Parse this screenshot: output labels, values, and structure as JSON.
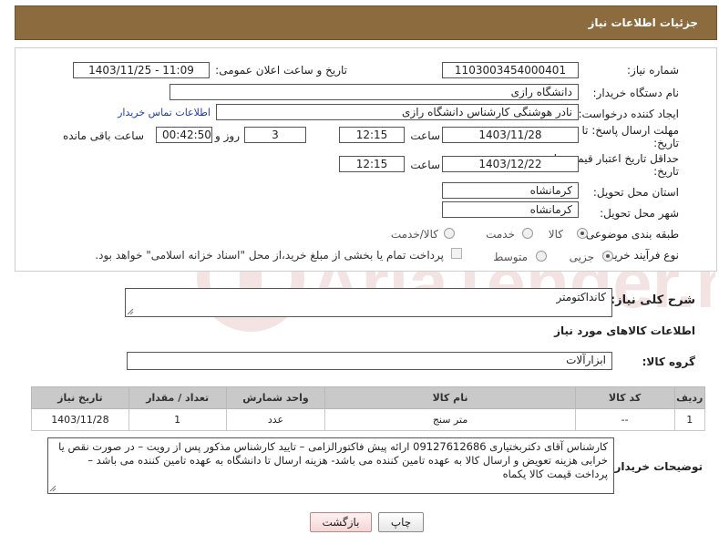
{
  "header": {
    "title": "جزئیات اطلاعات نیاز"
  },
  "form": {
    "need_number_label": "شماره نیاز:",
    "need_number": "1103003454000401",
    "announce_label": "تاریخ و ساعت اعلان عمومی:",
    "announce_value": "1403/11/25 - 11:09",
    "buyer_org_label": "نام دستگاه خریدار:",
    "buyer_org": "دانشگاه رازی",
    "requester_label": "ایجاد کننده درخواست:",
    "requester": "نادر هوشنگی کارشناس دانشگاه رازی",
    "contact_link": "اطلاعات تماس خریدار",
    "deadline_label_1": "مهلت ارسال پاسخ: تا",
    "deadline_label_2": "تاریخ:",
    "deadline_date": "1403/11/28",
    "time_label": "ساعت",
    "deadline_time": "12:15",
    "days_value": "3",
    "days_label": "روز و",
    "remaining_time": "00:42:50",
    "remaining_label": "ساعت باقی مانده",
    "validity_label_1": "حداقل تاریخ اعتبار قیمت: تا",
    "validity_label_2": "تاریخ:",
    "validity_date": "1403/12/22",
    "validity_time": "12:15",
    "province_label": "استان محل تحویل:",
    "province": "کرمانشاه",
    "city_label": "شهر محل تحویل:",
    "city": "کرمانشاه",
    "category_label": "طبقه بندی موضوعی:",
    "category_options": [
      "کالا",
      "خدمت",
      "کالا/خدمت"
    ],
    "category_selected": "کالا",
    "process_label": "نوع فرآیند خرید :",
    "process_options": [
      "جزیی",
      "متوسط"
    ],
    "process_selected": "جزیی",
    "payment_note": "پرداخت تمام یا بخشی از مبلغ خرید،از محل \"اسناد خزانه اسلامی\" خواهد بود."
  },
  "description": {
    "label": "شرح کلی نیاز:",
    "value": "کانداکتومتر"
  },
  "goods_section": {
    "title": "اطلاعات کالاهای مورد نیاز",
    "group_label": "گروه کالا:",
    "group_value": "ابزارآلات"
  },
  "table": {
    "headers": [
      "ردیف",
      "کد کالا",
      "نام کالا",
      "واحد شمارش",
      "تعداد / مقدار",
      "تاریخ نیاز"
    ],
    "rows": [
      [
        "1",
        "--",
        "متر سنج",
        "عدد",
        "1",
        "1403/11/28"
      ]
    ]
  },
  "buyer_notes": {
    "label": "توضیحات خریدار:",
    "value": "کارشناس آقای دکتربختیاری 09127612686  ارائه پیش فاکتورالزامی – تایید کارشناس مذکور پس از رویت – در صورت نقص یا خرابی هزینه تعویض و ارسال کالا به عهده تامین کننده می باشد- هزینه ارسال  تا دانشگاه به عهده تامین کننده می باشد – پرداخت قیمت کالا یکماه"
  },
  "buttons": {
    "print": "چاپ",
    "back": "بازگشت"
  },
  "watermark_text": "AriaTender.net",
  "colors": {
    "header": "#8c6b3e",
    "table_header": "#c9c9c9",
    "link": "#1a3fb0"
  }
}
